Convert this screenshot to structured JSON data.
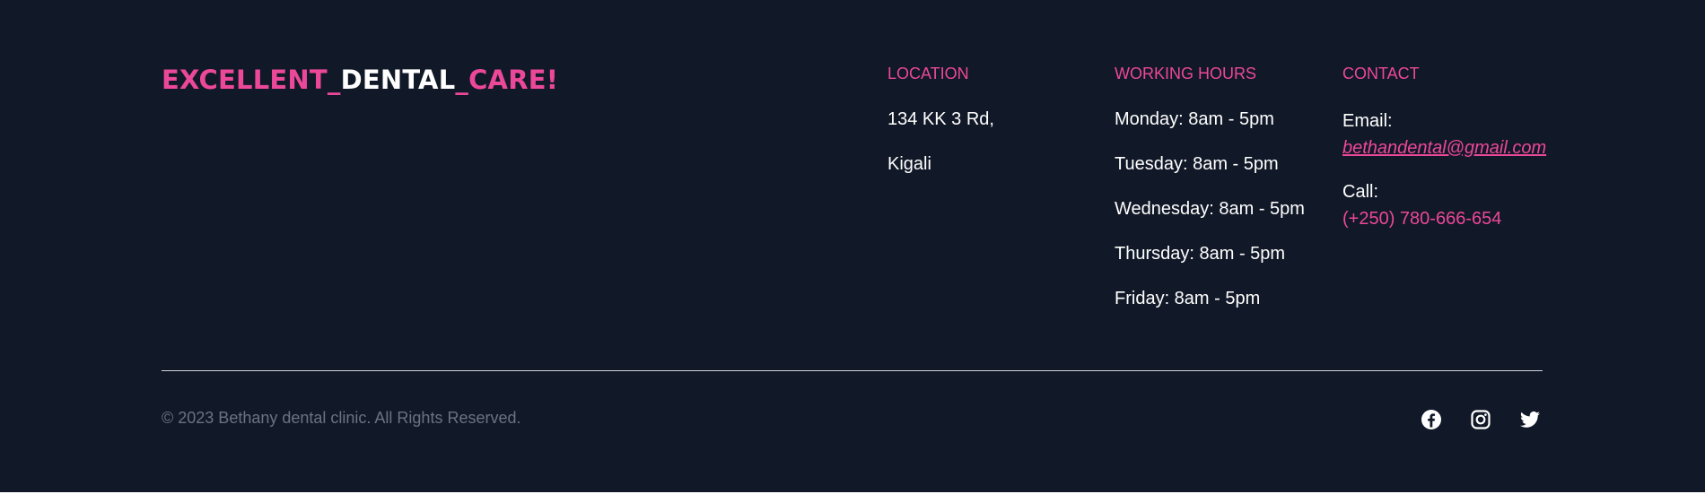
{
  "brand": {
    "part1": "EXCELLENT_",
    "part2": "DENTAL",
    "part3": "_CARE!"
  },
  "location": {
    "title": "LOCATION",
    "lines": [
      "134 KK 3 Rd,",
      "Kigali"
    ]
  },
  "hours": {
    "title": "WORKING HOURS",
    "lines": [
      "Monday: 8am - 5pm",
      "Tuesday: 8am - 5pm",
      "Wednesday: 8am - 5pm",
      "Thursday: 8am - 5pm",
      "Friday: 8am - 5pm"
    ]
  },
  "contact": {
    "title": "CONTACT",
    "email_label": "Email:",
    "email": "bethandental@gmail.com",
    "call_label": "Call:",
    "phone": "(+250) 780-666-654"
  },
  "copyright": "© 2023 Bethany dental clinic. All Rights Reserved.",
  "socials": [
    {
      "icon": "facebook-icon"
    },
    {
      "icon": "instagram-icon"
    },
    {
      "icon": "twitter-icon"
    }
  ],
  "colors": {
    "background": "#111827",
    "accent": "#ec4899",
    "text": "#ffffff",
    "muted": "#6b7280"
  }
}
